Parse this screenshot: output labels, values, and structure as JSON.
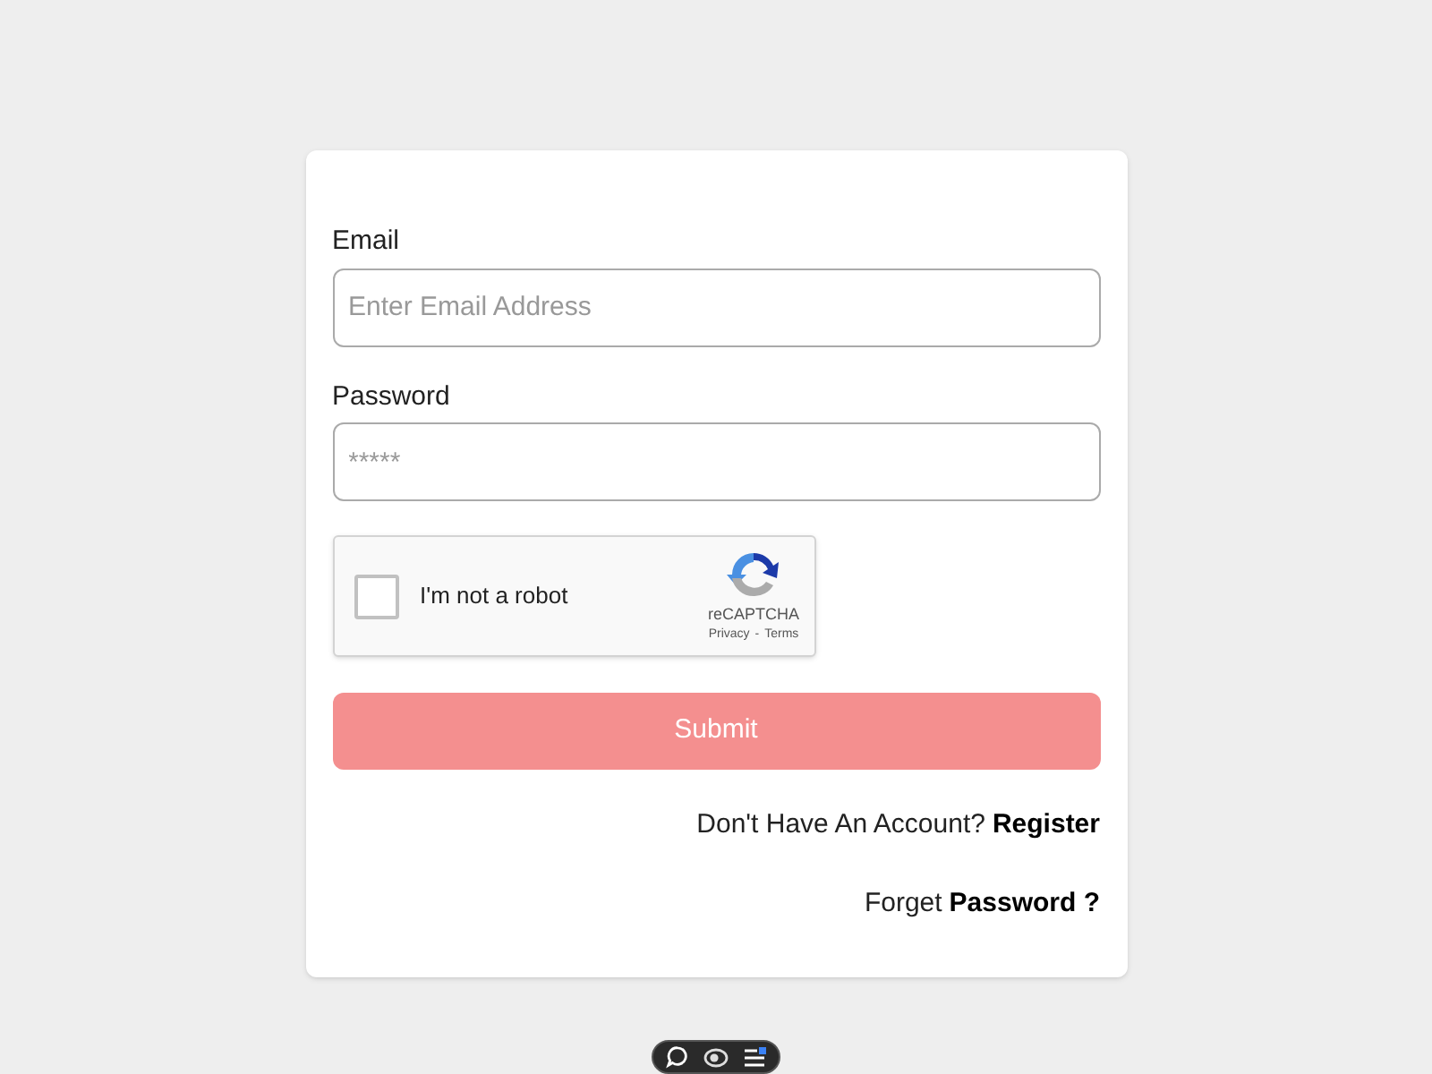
{
  "form": {
    "fields": [
      {
        "label": "Email",
        "placeholder": "Enter Email Address"
      },
      {
        "label": "Password",
        "placeholder": "*****"
      }
    ],
    "captcha": {
      "checked": false,
      "label": "I'm not a robot",
      "brand": "reCAPTCHA",
      "privacy": "Privacy",
      "separator": "-",
      "terms": "Terms"
    },
    "submit": "Submit",
    "register": {
      "prompt": "Don't Have An Account?",
      "link": "Register"
    },
    "forgot": {
      "prompt": "Forget",
      "link": "Password ?"
    }
  }
}
